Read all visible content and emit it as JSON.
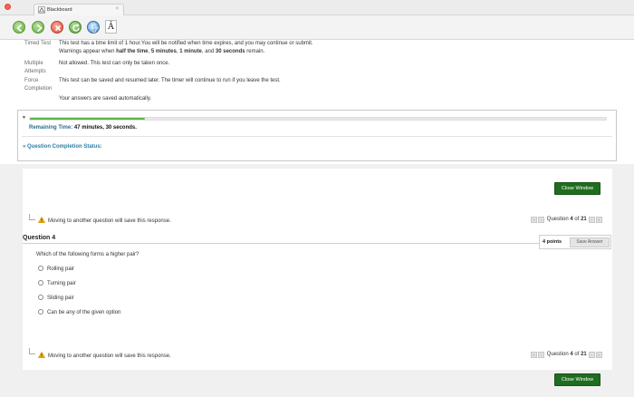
{
  "browser": {
    "tab_title": "Blackboard",
    "tab_close": "×",
    "font_button_glyph": "Ā"
  },
  "info": {
    "rows": [
      {
        "label": "Timed Test",
        "lines": [
          "This test has a time limit of 1 hour.You will be notified when time expires, and you may continue or submit.",
          "Warnings appear when half the time, 5 minutes, 1 minute, and 30 seconds remain."
        ]
      },
      {
        "label": "Multiple Attempts",
        "lines": [
          "Not allowed. This test can only be taken once."
        ]
      },
      {
        "label": "Force Completion",
        "lines": [
          "This test can be saved and resumed later. The timer will continue to run if you leave the test."
        ]
      },
      {
        "label": "",
        "lines": [
          "Your answers are saved automatically."
        ]
      }
    ],
    "warnings_prefix": "Warnings appear when ",
    "warnings_half": "half the time",
    "warnings_5": "5 minutes",
    "warnings_1": "1 minute",
    "warnings_and": ", and ",
    "warnings_30": "30 seconds",
    "warnings_suffix": " remain."
  },
  "timer": {
    "collapse_glyph": "▼",
    "progress_fraction": 0.2,
    "remaining_label": "Remaining Time:",
    "remaining_value": "47 minutes, 30 seconds.",
    "question_completion_status": "» Question Completion Status:"
  },
  "question_area": {
    "close_window_label": "Close Window",
    "save_notice": "Moving to another question will save this response.",
    "pager": {
      "prefix": "Question",
      "current": "4",
      "of": "of",
      "total": "21"
    },
    "question_heading": "Question 4",
    "points": "4 points",
    "save_answer_label": "Save Answer",
    "question_text": "Which of the following forms a higher pair?",
    "options": [
      "Rolling pair",
      "Turning  pair",
      "Sliding  pair",
      "Can be any of the given option"
    ]
  },
  "colors": {
    "accent_green": "#1f6d1f",
    "progress_green": "#58b947",
    "link_blue": "#2a7fa7"
  }
}
